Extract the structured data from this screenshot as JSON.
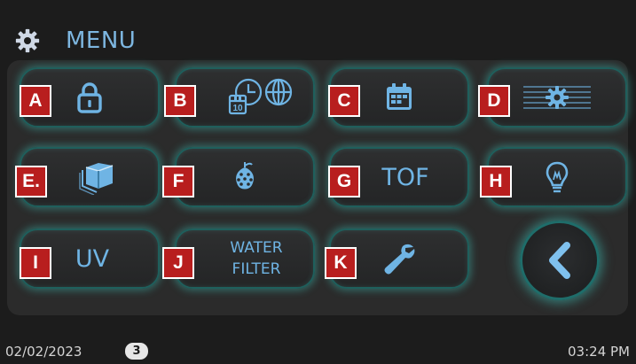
{
  "header": {
    "title": "MENU",
    "icon": "gear-icon"
  },
  "tiles": [
    {
      "letter": "A",
      "icon": "lock-icon"
    },
    {
      "letter": "B",
      "icon": "calendar-clock-globe-icon"
    },
    {
      "letter": "C",
      "icon": "calendar-icon"
    },
    {
      "letter": "D",
      "icon": "settings-list-icon"
    },
    {
      "letter": "E.",
      "icon": "ice-cube-icon"
    },
    {
      "letter": "F",
      "icon": "hops-icon"
    },
    {
      "letter": "G",
      "label": "TOF"
    },
    {
      "letter": "H",
      "icon": "light-bulb-icon"
    },
    {
      "letter": "I",
      "label": "UV"
    },
    {
      "letter": "J",
      "label_line1": "WATER",
      "label_line2": "FILTER"
    },
    {
      "letter": "K",
      "icon": "wrench-icon"
    }
  ],
  "back": {
    "icon": "chevron-left-icon"
  },
  "footer": {
    "date": "02/02/2023",
    "count": "3",
    "time": "03:24 PM"
  },
  "colors": {
    "accent": "#6fb4e4",
    "badge": "#b81e1e",
    "glow": "#3ebeb4",
    "background": "#1c1c1c",
    "panel": "#2b2b2b"
  }
}
